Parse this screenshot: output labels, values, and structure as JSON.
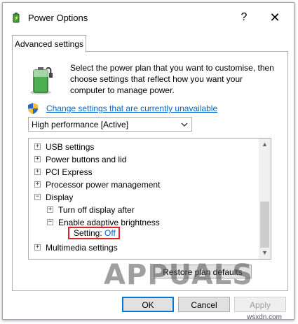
{
  "window": {
    "title": "Power Options",
    "help_glyph": "?",
    "close_glyph": "✕"
  },
  "tab": {
    "label": "Advanced settings"
  },
  "description": "Select the power plan that you want to customise, then choose settings that reflect how you want your computer to manage power.",
  "change_settings_link": "Change settings that are currently unavailable",
  "plan_dropdown": {
    "value": "High performance [Active]",
    "icon": "chevron-down-icon"
  },
  "tree": {
    "items": [
      {
        "label": "USB settings",
        "expander": "+"
      },
      {
        "label": "Power buttons and lid",
        "expander": "+"
      },
      {
        "label": "PCI Express",
        "expander": "+"
      },
      {
        "label": "Processor power management",
        "expander": "+"
      },
      {
        "label": "Display",
        "expander": "−"
      },
      {
        "label": "Turn off display after",
        "expander": "+"
      },
      {
        "label": "Enable adaptive brightness",
        "expander": "−"
      },
      {
        "label": "Multimedia settings",
        "expander": "+"
      }
    ],
    "setting": {
      "label": "Setting:",
      "value": "Off"
    },
    "scroll_up_glyph": "▲",
    "scroll_down_glyph": "▼"
  },
  "restore_button": "Restore plan defaults",
  "buttons": {
    "ok": "OK",
    "cancel": "Cancel",
    "apply": "Apply"
  },
  "watermark": "APPUALS",
  "site_watermark": "wsxdn.com",
  "colors": {
    "link": "#0066cc",
    "highlight_box": "#e0202a",
    "ok_border": "#0078d7"
  }
}
